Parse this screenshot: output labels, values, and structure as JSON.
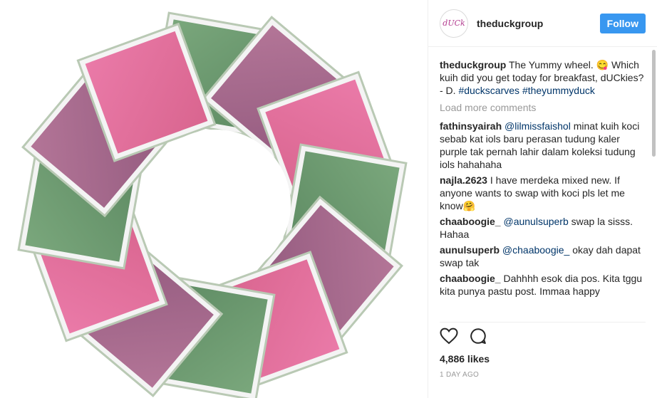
{
  "post": {
    "avatar_text": "dUCk",
    "username": "theduckgroup",
    "follow_label": "Follow"
  },
  "caption": {
    "user": "theduckgroup",
    "text": "The Yummy wheel. 😋 Which kuih did you get today for breakfast, dUCkies? - D.",
    "tag1": "#duckscarves",
    "tag2": "#theyummyduck"
  },
  "load_more_label": "Load more comments",
  "comments": [
    {
      "user": "fathinsyairah",
      "mention": "@lilmissfaishol",
      "text": "minat kuih koci sebab kat iols baru perasan tudung kaler purple tak pernah lahir dalam koleksi tudung iols hahahaha"
    },
    {
      "user": "najla.2623",
      "mention": "",
      "text": "I have merdeka mixed new. If anyone wants to swap with koci pls let me know🤗"
    },
    {
      "user": "chaaboogie_",
      "mention": "@aunulsuperb",
      "text": "swap la sisss. Hahaa"
    },
    {
      "user": "aunulsuperb",
      "mention": "@chaaboogie_",
      "text": "okay dah dapat swap tak"
    },
    {
      "user": "chaaboogie_",
      "mention": "",
      "text": "Dahhhh esok dia pos. Kita tggu kita punya pastu post. Immaa happy"
    }
  ],
  "likes_label": "4,886 likes",
  "time_label": "1 DAY AGO",
  "icons": {
    "like": "heart-icon",
    "comment": "comment-icon"
  },
  "colors": {
    "follow": "#3897f0",
    "pink": "#e2709f",
    "green": "#6f9a73",
    "mauve": "#a86a8f"
  }
}
